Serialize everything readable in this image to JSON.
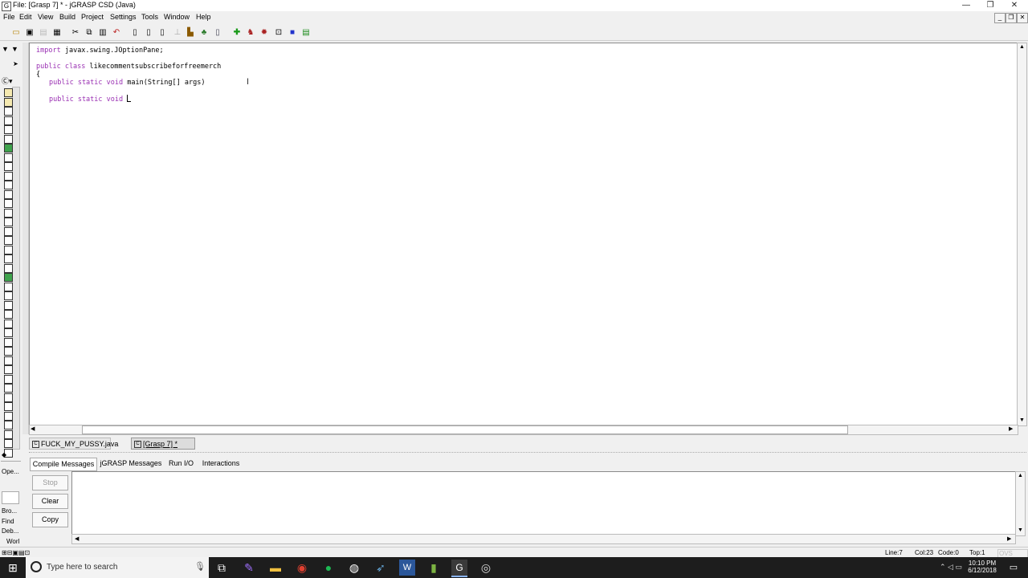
{
  "window": {
    "title": "File: [Grasp 7] * - jGRASP CSD (Java)",
    "app_icon": "jgrasp-g-icon",
    "controls": [
      "—",
      "❐",
      "✕"
    ]
  },
  "menubar": {
    "items": [
      "File",
      "Edit",
      "View",
      "Build",
      "Project",
      "Settings",
      "Tools",
      "Window",
      "Help"
    ]
  },
  "toolbar": {
    "icons": [
      "open-folder-icon",
      "save-icon",
      "save-all-icon",
      "print-icon",
      "cut-icon",
      "copy-icon",
      "paste-icon",
      "undo-icon",
      "page-icon",
      "page-icon",
      "page-icon",
      "pin-icon",
      "build-icon",
      "project-icon",
      "book-icon",
      "compile-icon",
      "run-icon",
      "debug-icon",
      "step-icon",
      "blue-square-icon",
      "green-grid-icon"
    ]
  },
  "editor": {
    "lines": [
      {
        "kw": "import",
        "rest": " javax.swing.JOptionPane;"
      },
      {
        "kw": "public class",
        "rest": " likecommentsubscribeforfreemerch"
      },
      {
        "kw": "",
        "rest": "{"
      },
      {
        "kw": "public static void",
        "rest": " main(String[] args)"
      },
      {
        "kw": "public static void",
        "rest": " "
      }
    ]
  },
  "editor_tabs": [
    {
      "label": "FUCK_MY_PUSSY.java",
      "active": false
    },
    {
      "label": "[Grasp 7] *",
      "active": true
    }
  ],
  "bottom_tabs": [
    "Compile Messages",
    "jGRASP Messages",
    "Run I/O",
    "Interactions"
  ],
  "bottom_buttons": {
    "stop": "Stop",
    "clear": "Clear",
    "copy": "Copy"
  },
  "side_labels": [
    "Ope...",
    "Bro...",
    "Find",
    "Deb...",
    "Worl"
  ],
  "status": {
    "line": "Line:7",
    "col": "Col:23",
    "code": "Code:0",
    "top": "Top:1",
    "mode": "OVS BLK"
  },
  "taskbar": {
    "search_placeholder": "Type here to search",
    "time": "10:10 PM",
    "date": "6/12/2018"
  },
  "colors": {
    "keyword": "#9a30b3",
    "taskbar": "#1d1d1d"
  }
}
